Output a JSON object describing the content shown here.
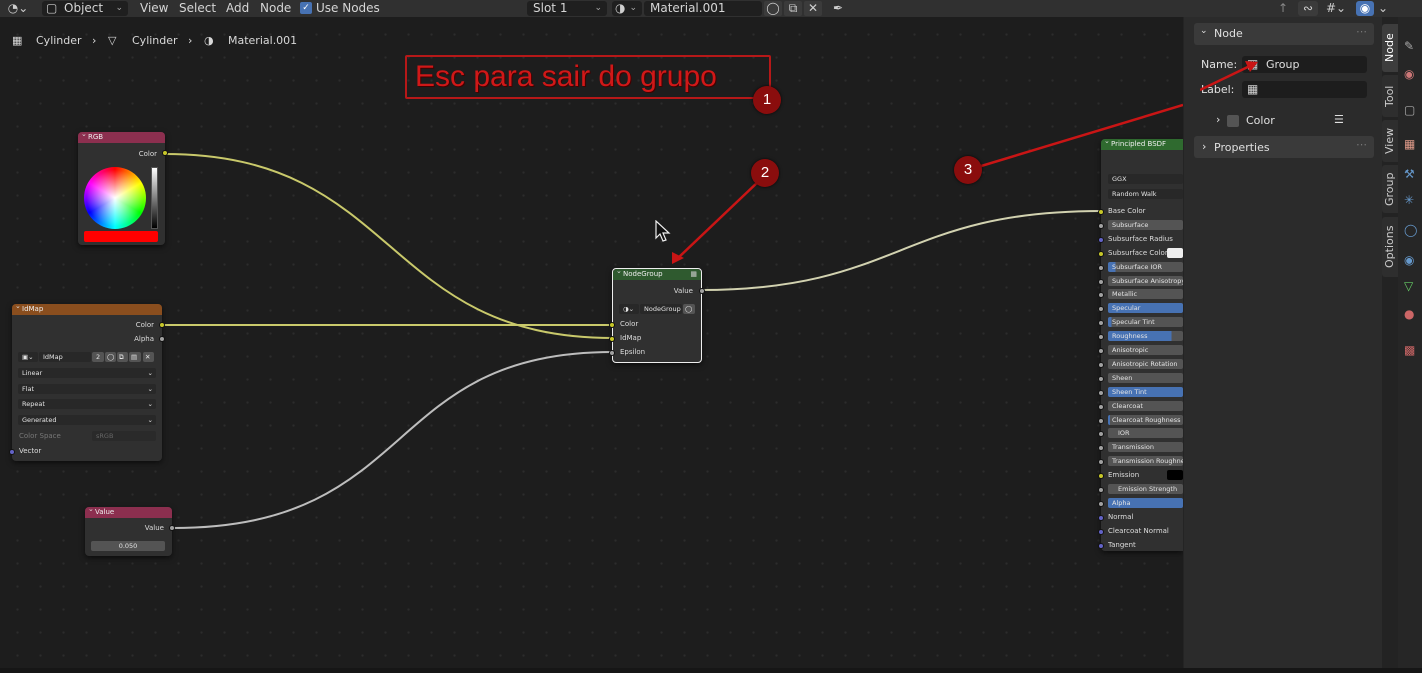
{
  "topbar": {
    "editor_type_icon": "node-editor-icon",
    "object_mode": "Object",
    "menus": [
      "View",
      "Select",
      "Add",
      "Node"
    ],
    "use_nodes_label": "Use Nodes",
    "use_nodes_checked": true,
    "slot": "Slot 1",
    "material": "Material.001"
  },
  "breadcrumb": {
    "object": "Cylinder",
    "mesh": "Cylinder",
    "material": "Material.001"
  },
  "annotation": {
    "text": "Esc para sair do grupo",
    "badges": [
      "1",
      "2",
      "3"
    ]
  },
  "nodes": {
    "rgb": {
      "title": "RGB",
      "output": "Color",
      "swatch_color": "#ff0000"
    },
    "idmap": {
      "title": "IdMap",
      "outputs": [
        "Color",
        "Alpha"
      ],
      "image_name": "IdMap",
      "users": "2",
      "interpolation": "Linear",
      "projection": "Flat",
      "extension": "Repeat",
      "source": "Generated",
      "color_space_label": "Color Space",
      "color_space": "sRGB",
      "input": "Vector"
    },
    "value": {
      "title": "Value",
      "output": "Value",
      "value": "0.050"
    },
    "group": {
      "title": "NodeGroup",
      "output": "Value",
      "tree": "NodeGroup",
      "inputs": [
        "Color",
        "IdMap",
        "Epsilon"
      ]
    },
    "bsdf": {
      "title": "Principled BSDF",
      "distribution": "GGX",
      "subsurface_method": "Random Walk",
      "inputs": [
        "Base Color",
        "Subsurface",
        "Subsurface Radius",
        "Subsurface Color",
        "Subsurface IOR",
        "Subsurface Anisotropy",
        "Metallic",
        "Specular",
        "Specular Tint",
        "Roughness",
        "Anisotropic",
        "Anisotropic Rotation",
        "Sheen",
        "Sheen Tint",
        "Clearcoat",
        "Clearcoat Roughness",
        "IOR",
        "Transmission",
        "Transmission Roughness",
        "Emission",
        "Emission Strength",
        "Alpha",
        "Normal",
        "Clearcoat Normal",
        "Tangent"
      ]
    }
  },
  "npanel": {
    "node_section": "Node",
    "name_label": "Name:",
    "name_value": "Group",
    "label_label": "Label:",
    "label_value": "",
    "color_label": "Color",
    "properties_section": "Properties",
    "tabs": [
      "Node",
      "Tool",
      "View",
      "Group",
      "Options"
    ]
  },
  "colors": {
    "annotation_red": "#d01818",
    "group_header": "#2f5a2f",
    "rgb_header": "#8c2f4f",
    "texture_header": "#8a4e1e",
    "value_header": "#8c2f4f",
    "bsdf_header": "#2f6a2f"
  }
}
